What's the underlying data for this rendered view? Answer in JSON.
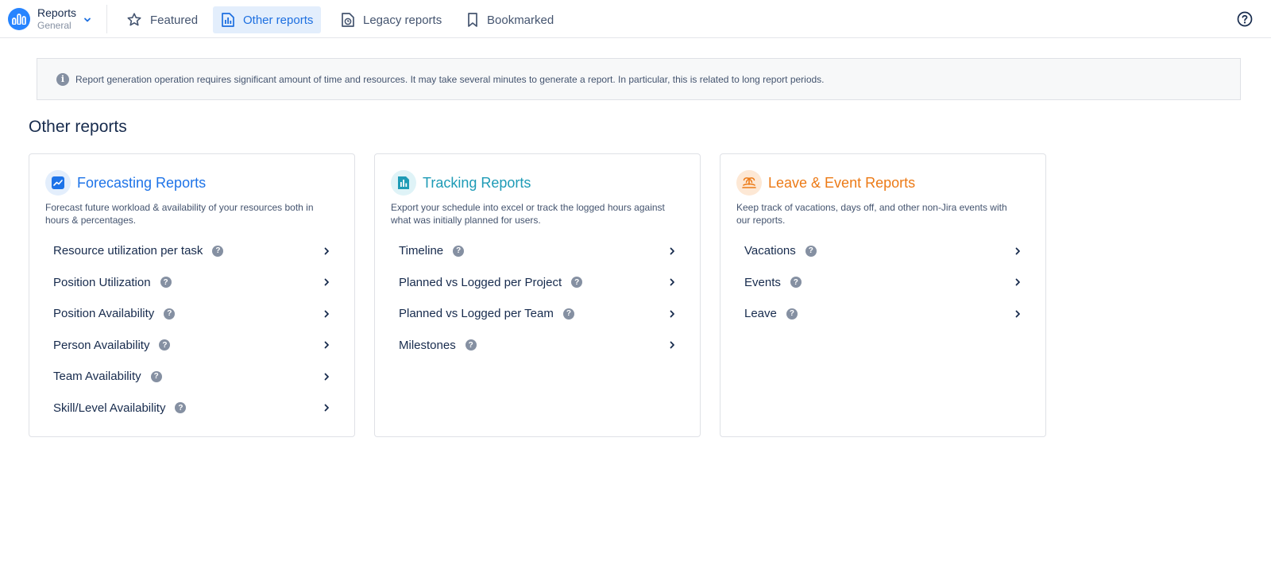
{
  "app": {
    "title": "Reports",
    "subtitle": "General"
  },
  "nav": {
    "featured": "Featured",
    "other": "Other reports",
    "legacy": "Legacy reports",
    "bookmarked": "Bookmarked"
  },
  "banner": {
    "text": "Report generation operation requires significant amount of time and resources. It may take several minutes to generate a report. In particular, this is related to long report periods."
  },
  "page": {
    "title": "Other reports"
  },
  "colors": {
    "forecasting": "#1d73e8",
    "tracking": "#1e9bb6",
    "leave": "#ec7a16",
    "active_tab": "#e3eefc"
  },
  "cards": [
    {
      "title": "Forecasting Reports",
      "description": "Forecast future workload & availability of your resources both in hours & percentages.",
      "icon": "trend-chart-icon",
      "items": [
        "Resource utilization per task",
        "Position Utilization",
        "Position Availability",
        "Person Availability",
        "Team Availability",
        "Skill/Level Availability"
      ]
    },
    {
      "title": "Tracking Reports",
      "description": "Export your schedule into excel or track the logged hours against what was initially planned for users.",
      "icon": "bar-chart-icon",
      "items": [
        "Timeline",
        "Planned vs Logged per Project",
        "Planned vs Logged per Team",
        "Milestones"
      ]
    },
    {
      "title": "Leave & Event Reports",
      "description": "Keep track of vacations, days off, and other non-Jira events with our reports.",
      "icon": "island-icon",
      "items": [
        "Vacations",
        "Events",
        "Leave"
      ]
    }
  ],
  "help_glyph": "?",
  "info_glyph": "i"
}
